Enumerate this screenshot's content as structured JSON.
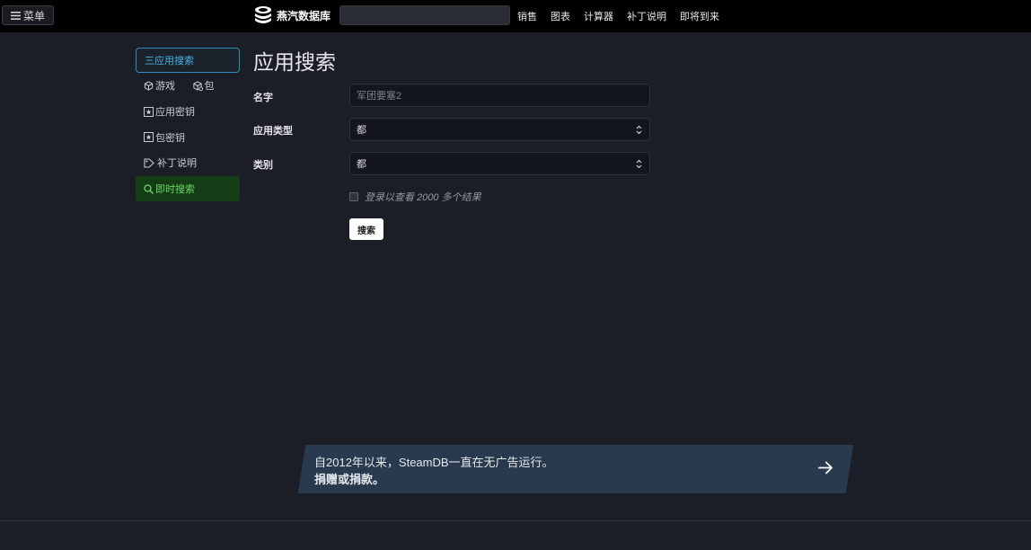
{
  "header": {
    "menu_label": "菜单",
    "logo_text": "燕汽数据库",
    "search_placeholder": "",
    "nav": [
      "销售",
      "图表",
      "计算器",
      "补丁说明",
      "即将到来"
    ]
  },
  "sidebar": {
    "active_item": "三应用搜索",
    "games_label": "游戏",
    "packages_label": "包",
    "app_keys_label": "应用密钥",
    "package_keys_label": "包密钥",
    "patchnotes_label": "补丁说明",
    "instant_search_label": "即时搜索"
  },
  "page": {
    "title": "应用搜索",
    "name_label": "名字",
    "name_placeholder": "军团要塞2",
    "app_type_label": "应用类型",
    "app_type_value": "都",
    "category_label": "类别",
    "category_value": "都",
    "checkbox_label": "登录以查看 2000 多个结果",
    "search_button": "搜索"
  },
  "banner": {
    "line1": "自2012年以来，SteamDB一直在无广告运行。",
    "line2": "捐赠或捐款。"
  },
  "colors": {
    "topbar": "#010101",
    "background": "#1b1e27",
    "active_accent": "#44b4e3",
    "live_search_bg": "#143d16",
    "live_search_text": "#6cd568",
    "banner_bg": "#293a4f"
  }
}
